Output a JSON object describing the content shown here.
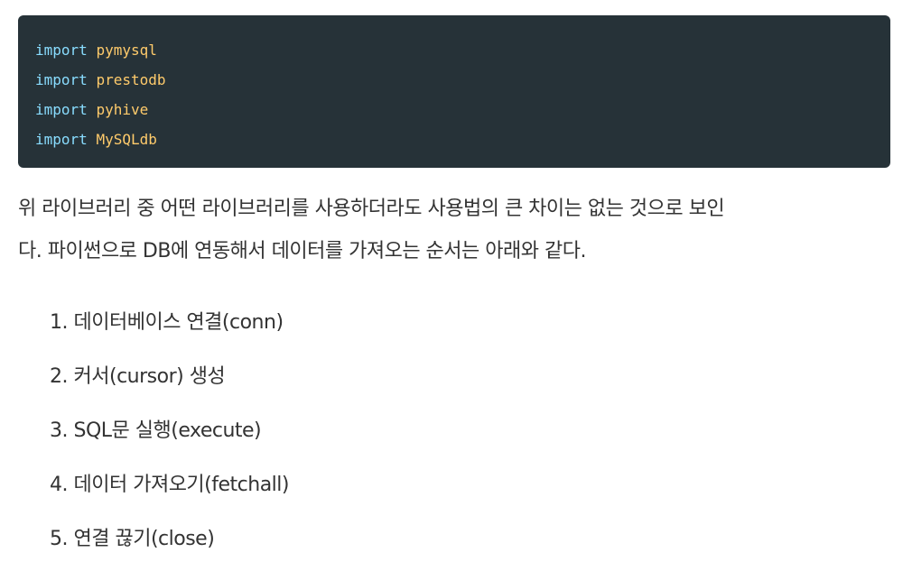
{
  "code": {
    "lines": [
      {
        "keyword": "import",
        "module": "pymysql"
      },
      {
        "keyword": "import",
        "module": "prestodb"
      },
      {
        "keyword": "import",
        "module": "pyhive"
      },
      {
        "keyword": "import",
        "module": "MySQLdb"
      }
    ]
  },
  "paragraph": {
    "line1": "위 라이브러리 중 어떤 라이브러리를 사용하더라도 사용법의 큰 차이는 없는 것으로 보인",
    "line2": "다. 파이썬으로 DB에 연동해서 데이터를 가져오는 순서는 아래와 같다."
  },
  "steps": [
    {
      "number": "1.",
      "text": "데이터베이스 연결(conn)"
    },
    {
      "number": "2.",
      "text": "커서(cursor) 생성"
    },
    {
      "number": "3.",
      "text": "SQL문 실행(execute)"
    },
    {
      "number": "4.",
      "text": "데이터 가져오기(fetchall)"
    },
    {
      "number": "5.",
      "text": "연결 끊기(close)"
    }
  ],
  "colors": {
    "code_background": "#263238",
    "keyword": "#89ddff",
    "module": "#ffcb6b",
    "body_text": "#333333"
  }
}
